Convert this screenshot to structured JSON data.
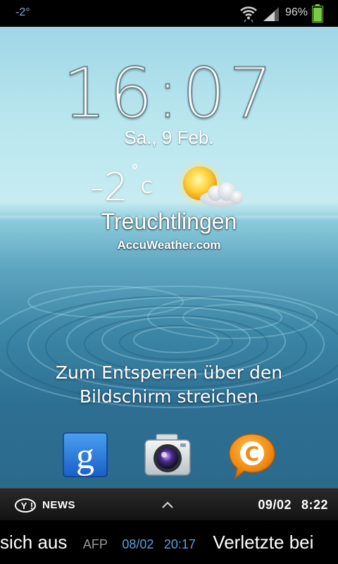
{
  "status_bar": {
    "temperature": "-2°",
    "battery_percent": "96%",
    "battery_level": 0.96,
    "icons": [
      "wifi-icon",
      "signal-icon",
      "battery-icon"
    ]
  },
  "lockscreen": {
    "time": "16:07",
    "date": "Sa., 9 Feb.",
    "weather": {
      "temperature": "-2",
      "unit": "C",
      "degree_symbol": "°",
      "city": "Treuchtlingen",
      "provider": "AccuWeather.com",
      "icon": "sun-cloud-icon"
    },
    "unlock_hint": "Zum Entsperren über den Bildschirm streichen",
    "apps": [
      {
        "name": "google-search",
        "icon": "google-icon"
      },
      {
        "name": "camera",
        "icon": "camera-icon"
      },
      {
        "name": "chaton",
        "icon": "chaton-icon"
      }
    ]
  },
  "news_bar": {
    "label": "NEWS",
    "logo": "yahoo-logo",
    "date": "09/02",
    "time": "8:22"
  },
  "ticker": {
    "headline_tail": "sich aus",
    "source": "AFP",
    "date": "08/02",
    "time": "20:17",
    "next_headline": "Verletzte bei"
  },
  "colors": {
    "ticker_datetime": "#5aa2dc",
    "status_temp": "#7fb0d6",
    "battery": "#7ac943"
  }
}
